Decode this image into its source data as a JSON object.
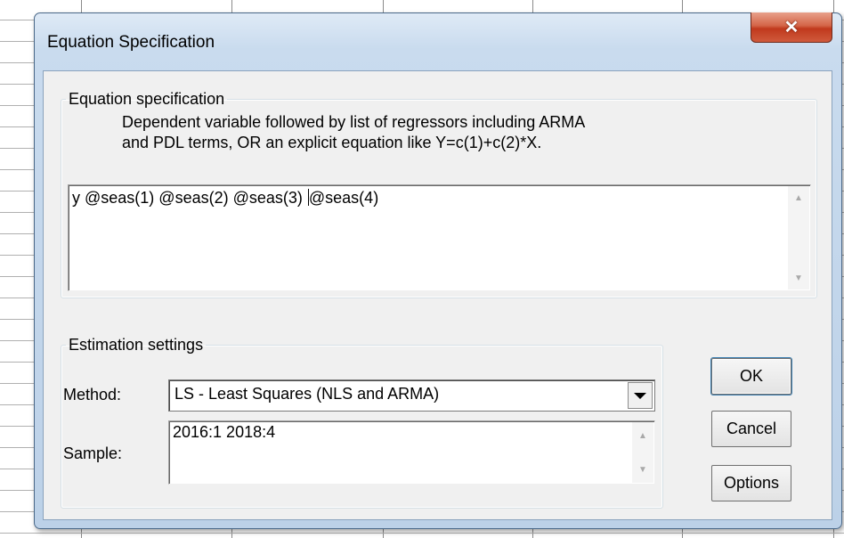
{
  "dialog": {
    "title": "Equation Specification",
    "close_icon": "close-icon",
    "spec_group": {
      "legend": "Equation specification",
      "description_line1": "Dependent variable followed by list of regressors including ARMA",
      "description_line2": "and PDL terms, OR an explicit equation like Y=c(1)+c(2)*X.",
      "text_before_caret": "y @seas(1) @seas(2) @seas(3) ",
      "text_after_caret": "@seas(4)"
    },
    "estimation_group": {
      "legend": "Estimation settings",
      "method_label": "Method:",
      "method_value": "LS  -  Least Squares (NLS and ARMA)",
      "sample_label": "Sample:",
      "sample_value": "2016:1 2018:4"
    },
    "buttons": {
      "ok": "OK",
      "cancel": "Cancel",
      "options": "Options"
    }
  },
  "colors": {
    "close_button": "#c0391d",
    "title_bar": "#c9dbee",
    "client_bg": "#f0f0f0"
  }
}
